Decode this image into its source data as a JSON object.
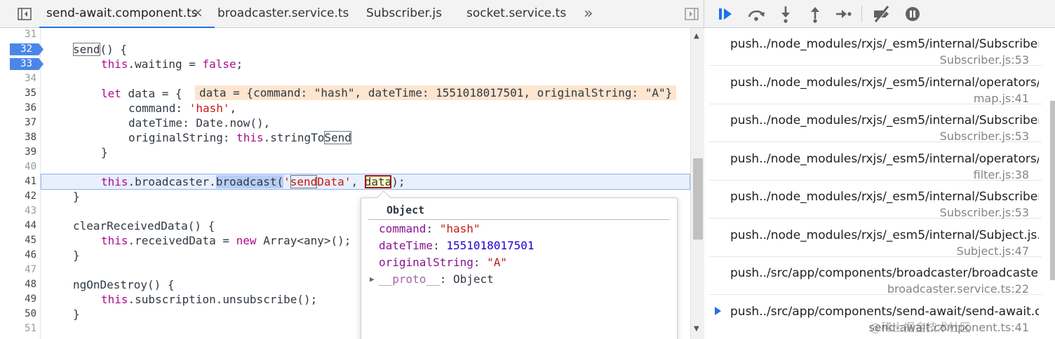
{
  "tabs": [
    {
      "label": "send-await.component.ts",
      "active": true,
      "closable": true
    },
    {
      "label": "broadcaster.service.ts"
    },
    {
      "label": "Subscriber.js"
    },
    {
      "label": "socket.service.ts"
    }
  ],
  "tabs_more": "»",
  "icons": {
    "toggle_navigator": "sidebar-toggle-icon",
    "toggle_debugger": "sidebar-toggle-icon",
    "tab_overflow": "chevron-double-right-icon",
    "resume": "resume-icon",
    "step_over": "step-over-icon",
    "step_into": "step-into-icon",
    "step_out": "step-out-icon",
    "step": "step-icon",
    "deactivate_breakpoints": "deactivate-breakpoints-icon",
    "pause_on_exceptions": "pause-on-exceptions-icon"
  },
  "colors": {
    "accent": "#1a73e8",
    "breakpoint": "#4a86e8",
    "keyword": "#aa0d91",
    "string": "#c41a16",
    "inline_value_bg": "#fde5cf"
  },
  "editor": {
    "line_numbers": [
      "31",
      "32",
      "33",
      "34",
      "35",
      "36",
      "37",
      "38",
      "39",
      "40",
      "41",
      "42",
      "43",
      "44",
      "45",
      "46",
      "47",
      "48",
      "49",
      "50",
      "51"
    ],
    "breakpoints": [
      "32",
      "33"
    ],
    "execution_line": "41",
    "lines": {
      "l32a": "send",
      "l32b": "() {",
      "l33a": "this",
      "l33b": ".waiting = ",
      "l33c": "false",
      "l33d": ";",
      "l35a": "let",
      "l35b": " data = {",
      "l36a": "command: ",
      "l36b": "'hash'",
      "l36c": ",",
      "l37": "dateTime: Date.now(),",
      "l38a": "originalString: ",
      "l38b": "this",
      "l38c": ".stringTo",
      "l38d": "Send",
      "l39": "}",
      "l41a": "this",
      "l41b": ".broadcaster.",
      "l41c": "broadcast",
      "l41d": "(",
      "l41e": "'",
      "l41f": "send",
      "l41g": "Data'",
      "l41h": ", ",
      "l41i": "data",
      "l41j": ");",
      "l42": "}",
      "l44": "clearReceivedData() {",
      "l45a": "this",
      "l45b": ".receivedData = ",
      "l45c": "new",
      "l45d": " Array<any>();",
      "l46": "}",
      "l48": "ngOnDestroy() {",
      "l49a": "this",
      "l49b": ".subscription.unsubscribe();",
      "l50": "}"
    },
    "inline_value": "data = {command: \"hash\", dateTime: 1551018017501, originalString: \"A\"}"
  },
  "popover": {
    "title": "Object",
    "props": [
      {
        "key": "command",
        "sep": ": ",
        "value": "\"hash\"",
        "type": "string"
      },
      {
        "key": "dateTime",
        "sep": ": ",
        "value": "1551018017501",
        "type": "number"
      },
      {
        "key": "originalString",
        "sep": ": ",
        "value": "\"A\"",
        "type": "string"
      },
      {
        "key": "__proto__",
        "sep": ": ",
        "value": "Object",
        "type": "object"
      }
    ]
  },
  "call_stack": [
    {
      "function": "push../node_modules/rxjs/_esm5/internal/Subscriber.js...",
      "location": "Subscriber.js:53"
    },
    {
      "function": "push../node_modules/rxjs/_esm5/internal/operators/...",
      "location": "map.js:41"
    },
    {
      "function": "push../node_modules/rxjs/_esm5/internal/Subscriber.js...",
      "location": "Subscriber.js:53"
    },
    {
      "function": "push../node_modules/rxjs/_esm5/internal/operators/fi...",
      "location": "filter.js:38"
    },
    {
      "function": "push../node_modules/rxjs/_esm5/internal/Subscriber.js...",
      "location": "Subscriber.js:53"
    },
    {
      "function": "push../node_modules/rxjs/_esm5/internal/Subject.js.S...",
      "location": "Subject.js:47"
    },
    {
      "function": "push../src/app/components/broadcaster/broadcaster....",
      "location": "broadcaster.service.ts:22"
    },
    {
      "function": "push../src/app/components/send-await/send-await.c...",
      "location": "send-await.component.ts:41",
      "current": true
    }
  ],
  "watermark": "@稀土掘金技术社区"
}
